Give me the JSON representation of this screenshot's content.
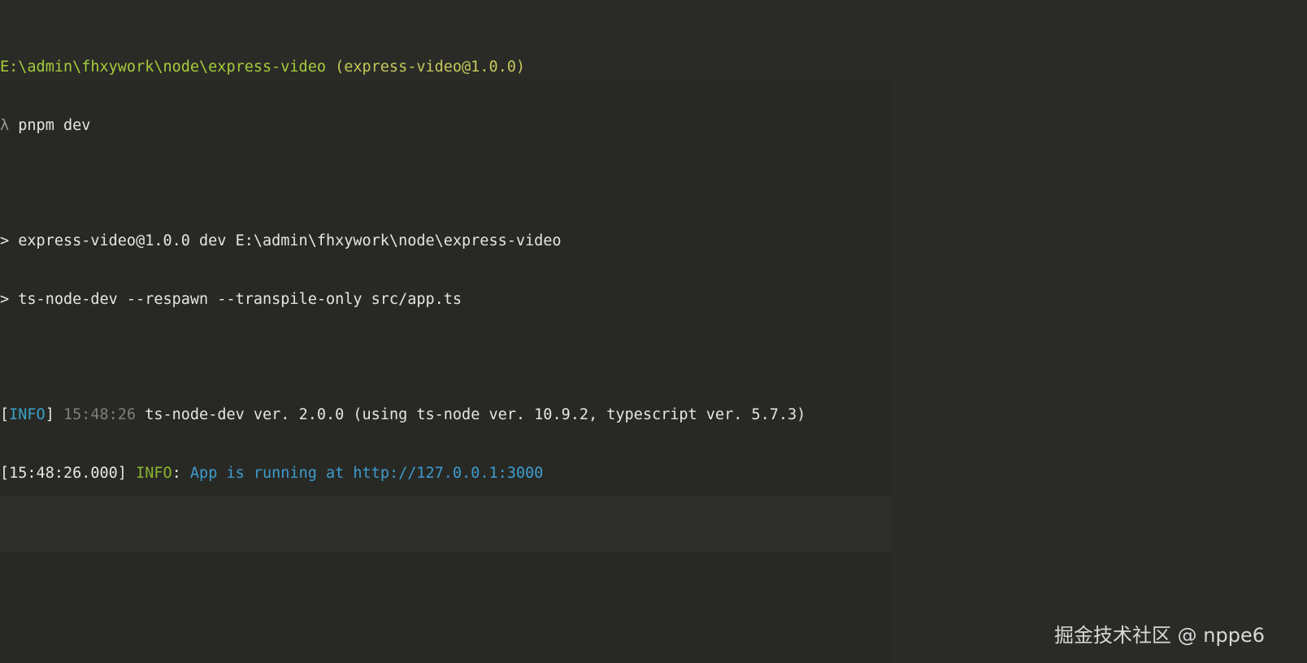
{
  "terminal": {
    "prompt_path": "E:\\admin\\fhxywork\\node\\express-video",
    "prompt_pkg": "(express-video@1.0.0)",
    "prompt_symbol": "λ",
    "command": "pnpm dev",
    "script_line_1": "> express-video@1.0.0 dev E:\\admin\\fhxywork\\node\\express-video",
    "script_line_2": "> ts-node-dev --respawn --transpile-only src/app.ts",
    "log1": {
      "open_bracket": "[",
      "level": "INFO",
      "close_bracket": "]",
      "time": "15:48:26",
      "message": "ts-node-dev ver. 2.0.0 (using ts-node ver. 10.9.2, typescript ver. 5.7.3)"
    },
    "log2": {
      "timestamp": "[15:48:26.000]",
      "level": "INFO",
      "separator": ":",
      "message": "App is running at http://127.0.0.1:3000"
    }
  },
  "watermark": "掘金技术社区 @ nppe6",
  "colors": {
    "background": "#2a2b27",
    "path_green": "#a6cc3b",
    "info_blue": "#3aa0c8",
    "info_green": "#8ab52f"
  }
}
